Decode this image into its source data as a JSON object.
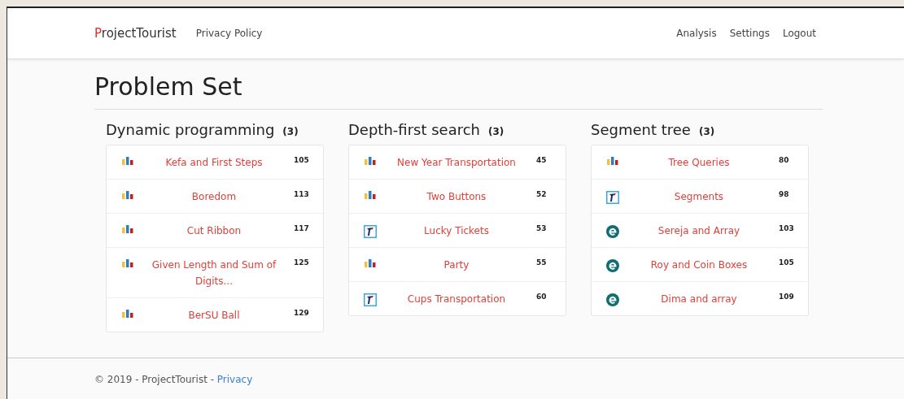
{
  "navbar": {
    "brand": "ProjectTourist",
    "links": [
      "Privacy Policy"
    ],
    "right_links": [
      "Analysis",
      "Settings",
      "Logout"
    ]
  },
  "page_title": "Problem Set",
  "categories": [
    {
      "name": "Dynamic programming",
      "count": "(3)",
      "problems": [
        {
          "kind": "bars",
          "title": "Kefa and First Steps",
          "number": "105"
        },
        {
          "kind": "bars",
          "title": "Boredom",
          "number": "113"
        },
        {
          "kind": "bars",
          "title": "Cut Ribbon",
          "number": "117"
        },
        {
          "kind": "bars",
          "title": "Given Length and Sum of Digits...",
          "number": "125"
        },
        {
          "kind": "bars",
          "title": "BerSU Ball",
          "number": "129"
        }
      ]
    },
    {
      "name": "Depth-first search",
      "count": "(3)",
      "problems": [
        {
          "kind": "bars",
          "title": "New Year Transportation",
          "number": "45"
        },
        {
          "kind": "bars",
          "title": "Two Buttons",
          "number": "52"
        },
        {
          "kind": "figure",
          "title": "Lucky Tickets",
          "number": "53"
        },
        {
          "kind": "bars",
          "title": "Party",
          "number": "55"
        },
        {
          "kind": "figure",
          "title": "Cups Transportation",
          "number": "60"
        }
      ]
    },
    {
      "name": "Segment tree",
      "count": "(3)",
      "problems": [
        {
          "kind": "bars",
          "title": "Tree Queries",
          "number": "80"
        },
        {
          "kind": "figure",
          "title": "Segments",
          "number": "98"
        },
        {
          "kind": "e",
          "title": "Sereja and Array",
          "number": "103"
        },
        {
          "kind": "e",
          "title": "Roy and Coin Boxes",
          "number": "105"
        },
        {
          "kind": "e",
          "title": "Dima and array",
          "number": "109"
        }
      ]
    }
  ],
  "footer": {
    "text": "© 2019 - ProjectTourist -",
    "link": "Privacy"
  }
}
